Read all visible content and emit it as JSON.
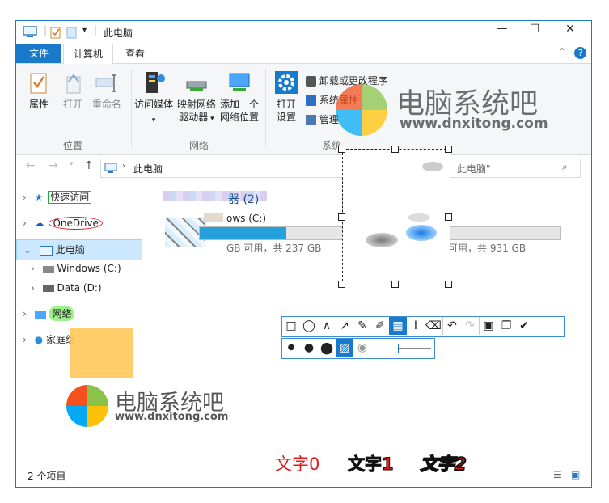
{
  "window": {
    "title": "此电脑",
    "min_label": "—",
    "max_label": "☐",
    "close_label": "✕"
  },
  "ribbon_tabs": {
    "file": "文件",
    "computer": "计算机",
    "view": "查看"
  },
  "ribbon": {
    "properties": "属性",
    "open": "打开",
    "rename": "重命名",
    "access_media_1": "访问媒体",
    "map_drive_1": "映射网络",
    "map_drive_2": "驱动器",
    "add_location_1": "添加一个",
    "add_location_2": "网络位置",
    "open_settings_1": "打开",
    "open_settings_2": "设置",
    "uninstall": "卸载或更改程序",
    "system_props": "系统属性",
    "manage": "管理",
    "group_location": "位置",
    "group_network": "网络",
    "group_system": "系统"
  },
  "address": {
    "path": "此电脑",
    "search_placeholder": "此电脑\""
  },
  "nav": {
    "quick_access": "快速访问",
    "onedrive": "OneDrive",
    "this_pc": "此电脑",
    "windows_c": "Windows (C:)",
    "data_d": "Data (D:)",
    "network": "网络",
    "homegroup": "家庭组"
  },
  "content": {
    "devices_header": "器 (2)",
    "drive_c_name": "ows (C:)",
    "drive_c_free": "GB 可用，共 237 GB",
    "drive_c_fill": 0.6,
    "drive_d_free": "可用，共 931 GB",
    "drive_d_fill": 0.0
  },
  "status": {
    "items": "2 个项目"
  },
  "watermark": {
    "top_text": "电脑系统吧",
    "top_url": "www.dnxitong.com",
    "bottom_text": "电脑系统吧",
    "bottom_url": "www.dnxitong.com"
  },
  "annotations": {
    "text0": "文字0",
    "text1": "文字1",
    "text2": "文字2"
  },
  "colors": {
    "accent": "#1979ca",
    "annotation_red": "#e11b1b",
    "highlight_green": "#9ef08a",
    "rect_fill": "#ffc95a"
  }
}
